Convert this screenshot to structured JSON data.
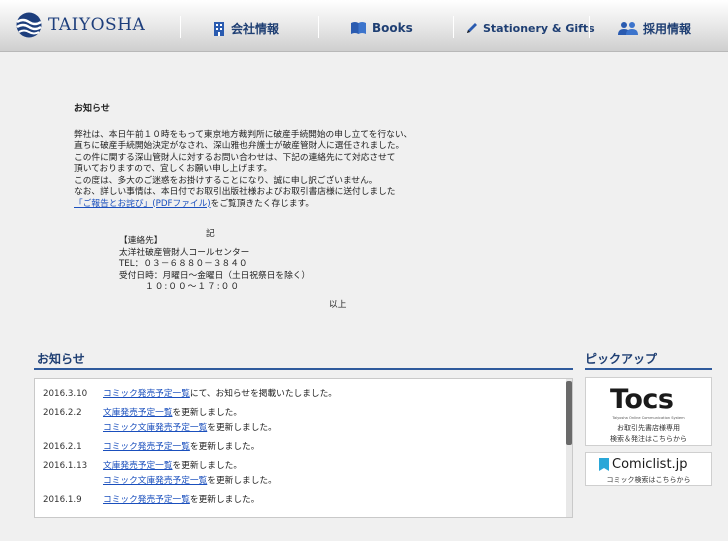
{
  "header": {
    "logo_text": "TAIYOSHA",
    "nav": [
      {
        "label": "会社情報",
        "icon": "building-icon"
      },
      {
        "label": "Books",
        "icon": "book-icon"
      },
      {
        "label": "Stationery & Gifts",
        "icon": "pencil-icon"
      },
      {
        "label": "採用情報",
        "icon": "people-icon"
      }
    ]
  },
  "notice": {
    "title": "お知らせ",
    "lines": [
      "弊社は、本日午前１０時をもって東京地方裁判所に破産手続開始の申し立てを行ない、",
      "直ちに破産手続開始決定がなされ、深山雅也弁護士が破産管財人に選任されました。",
      "この件に関する深山管財人に対するお問い合わせは、下記の連絡先にて対応させて",
      "頂いておりますので、宜しくお願い申し上げます。",
      "この度は、多大のご迷惑をお掛けすることになり、誠に申し訳ございません。",
      "なお、詳しい事情は、本日付でお取引出版社様およびお取引書店様に送付しました"
    ],
    "link_text": "「ご報告とお詫び」(PDFファイル)",
    "after_link": "をご覧頂きたく存じます。",
    "ki": "記",
    "contact_lines": [
      "【連絡先】",
      "太洋社破産管財人コールセンター",
      "TEL：０３－６８８０－３８４０",
      "受付日時：月曜日～金曜日（土日祝祭日を除く）"
    ],
    "hours": "１０:００～１７:００",
    "ijou": "以上"
  },
  "news": {
    "heading": "お知らせ",
    "items": [
      {
        "date": "2016.3.10",
        "lines": [
          {
            "link": "コミック発売予定一覧",
            "text": "にて、お知らせを掲載いたしました。"
          }
        ]
      },
      {
        "date": "2016.2.2",
        "lines": [
          {
            "link": "文庫発売予定一覧",
            "text": "を更新しました。"
          },
          {
            "link": "コミック文庫発売予定一覧",
            "text": "を更新しました。"
          }
        ]
      },
      {
        "date": "2016.2.1",
        "lines": [
          {
            "link": "コミック発売予定一覧",
            "text": "を更新しました。"
          }
        ]
      },
      {
        "date": "2016.1.13",
        "lines": [
          {
            "link": "文庫発売予定一覧",
            "text": "を更新しました。"
          },
          {
            "link": "コミック文庫発売予定一覧",
            "text": "を更新しました。"
          }
        ]
      },
      {
        "date": "2016.1.9",
        "lines": [
          {
            "link": "コミック発売予定一覧",
            "text": "を更新しました。"
          }
        ]
      }
    ]
  },
  "pickup": {
    "heading": "ピックアップ",
    "tocs": {
      "logo": "Tocs",
      "subtitle": "Taiyosha Online Communication System",
      "line1": "お取引先書店様専用",
      "line2": "検索＆発注はこちらから"
    },
    "comiclist": {
      "logo": "Comiclist.jp",
      "sub": "コミック検索はこちらから"
    }
  },
  "colors": {
    "brand": "#1f3f73",
    "link": "#1a4fbd",
    "rule": "#2f5a9c"
  }
}
